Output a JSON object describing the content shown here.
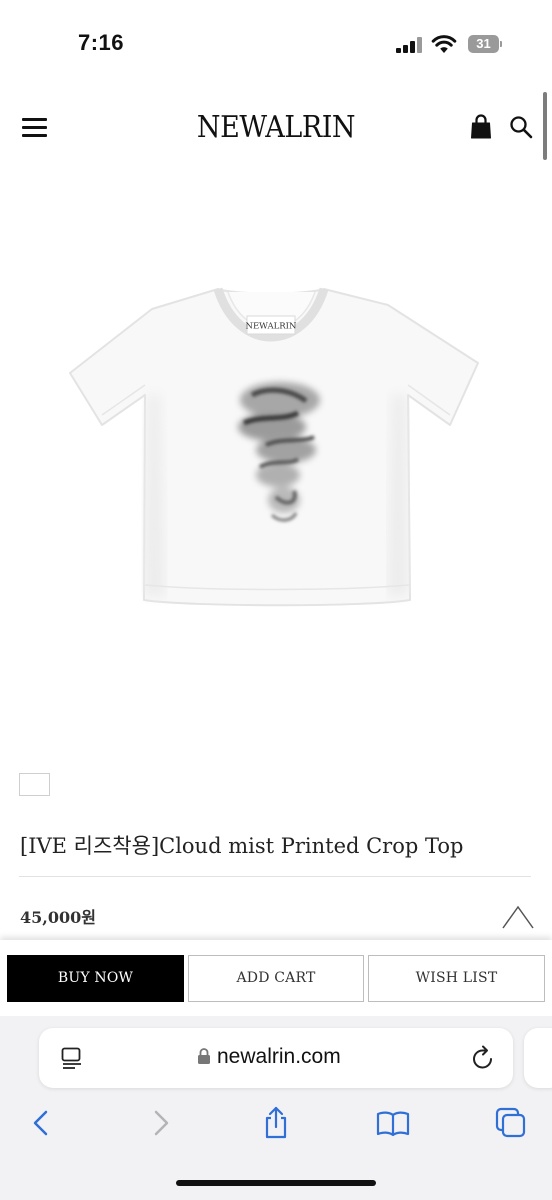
{
  "status_bar": {
    "time": "7:16",
    "battery_level": "31",
    "signal_icon": "cellular-signal-icon",
    "wifi_icon": "wifi-icon"
  },
  "header": {
    "logo": "NEWALRIN",
    "menu_icon": "hamburger-menu-icon",
    "cart_icon": "shopping-bag-icon",
    "search_icon": "search-icon"
  },
  "product": {
    "neck_label": "NEWALRIN",
    "title": "[IVE 리즈착용]Cloud mist Printed Crop Top",
    "price": "45,000원",
    "swatch_color": "#ffffff"
  },
  "actions": {
    "buy_now": "BUY NOW",
    "add_cart": "ADD CART",
    "wish_list": "WISH LIST"
  },
  "browser": {
    "url": "newalrin.com",
    "toolbar": [
      "back-icon",
      "forward-icon",
      "share-icon",
      "bookmarks-icon",
      "tabs-icon"
    ]
  },
  "colors": {
    "accent": "#000000",
    "browser_blue": "#2f6fd6",
    "browser_disabled": "#b4b4b8"
  }
}
